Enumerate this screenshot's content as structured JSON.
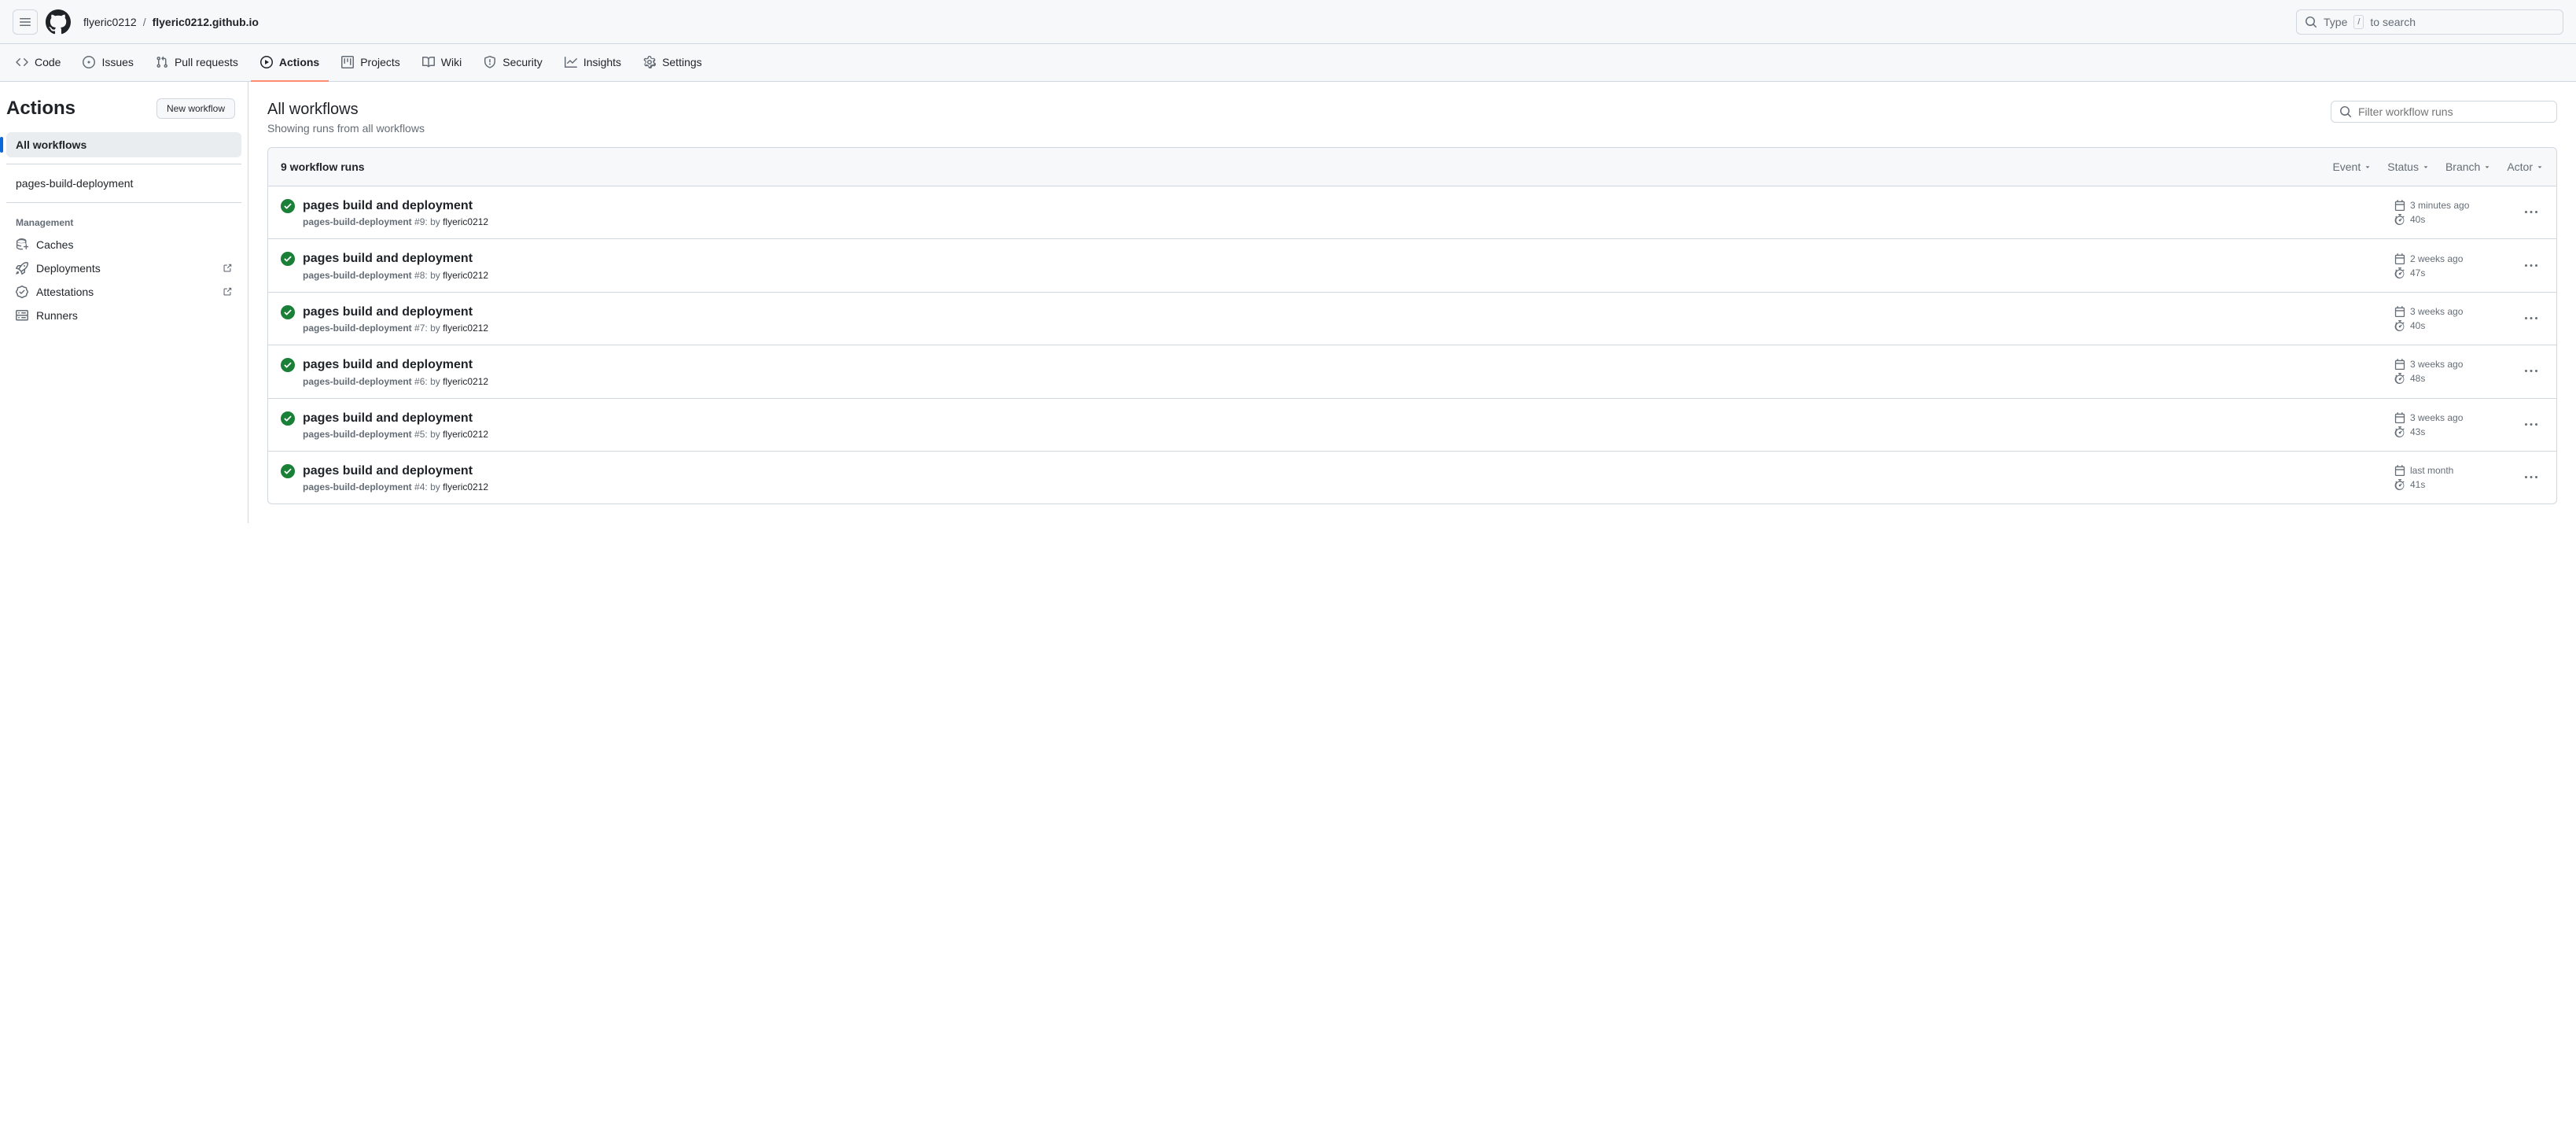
{
  "header": {
    "owner": "flyeric0212",
    "repo": "flyeric0212.github.io",
    "search_prefix": "Type ",
    "search_key": "/",
    "search_suffix": " to search"
  },
  "nav": {
    "code": "Code",
    "issues": "Issues",
    "pulls": "Pull requests",
    "actions": "Actions",
    "projects": "Projects",
    "wiki": "Wiki",
    "security": "Security",
    "insights": "Insights",
    "settings": "Settings"
  },
  "sidebar": {
    "title": "Actions",
    "new_wf": "New workflow",
    "all": "All workflows",
    "workflows": [
      {
        "name": "pages-build-deployment"
      }
    ],
    "mgmt_title": "Management",
    "caches": "Caches",
    "deployments": "Deployments",
    "attestations": "Attestations",
    "runners": "Runners"
  },
  "main": {
    "title": "All workflows",
    "subtitle": "Showing runs from all workflows",
    "filter_placeholder": "Filter workflow runs",
    "count_label": "9 workflow runs",
    "dd_event": "Event",
    "dd_status": "Status",
    "dd_branch": "Branch",
    "dd_actor": "Actor",
    "by_text": "by",
    "runs": [
      {
        "title": "pages build and deployment",
        "workflow": "pages-build-deployment",
        "run_no": "#9:",
        "author": "flyeric0212",
        "time": "3 minutes ago",
        "duration": "40s"
      },
      {
        "title": "pages build and deployment",
        "workflow": "pages-build-deployment",
        "run_no": "#8:",
        "author": "flyeric0212",
        "time": "2 weeks ago",
        "duration": "47s"
      },
      {
        "title": "pages build and deployment",
        "workflow": "pages-build-deployment",
        "run_no": "#7:",
        "author": "flyeric0212",
        "time": "3 weeks ago",
        "duration": "40s"
      },
      {
        "title": "pages build and deployment",
        "workflow": "pages-build-deployment",
        "run_no": "#6:",
        "author": "flyeric0212",
        "time": "3 weeks ago",
        "duration": "48s"
      },
      {
        "title": "pages build and deployment",
        "workflow": "pages-build-deployment",
        "run_no": "#5:",
        "author": "flyeric0212",
        "time": "3 weeks ago",
        "duration": "43s"
      },
      {
        "title": "pages build and deployment",
        "workflow": "pages-build-deployment",
        "run_no": "#4:",
        "author": "flyeric0212",
        "time": "last month",
        "duration": "41s"
      }
    ]
  }
}
